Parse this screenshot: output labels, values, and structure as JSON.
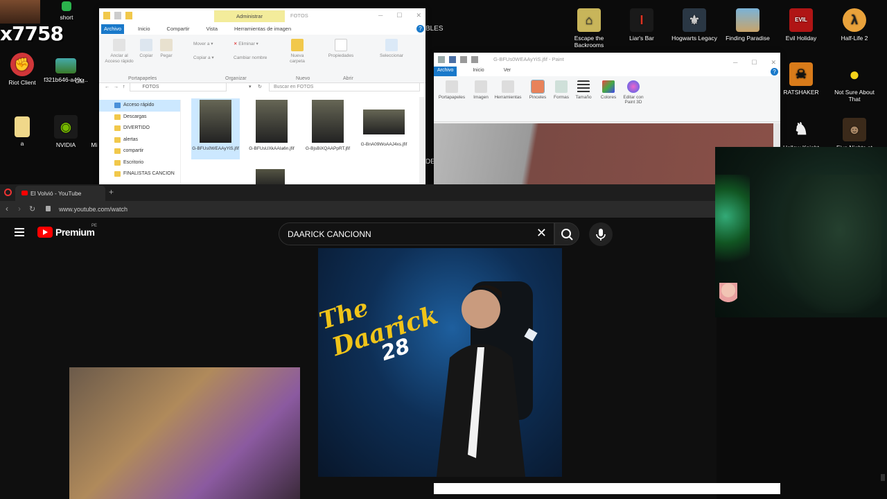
{
  "desktop": {
    "overlay_number": "x7758",
    "icons": [
      {
        "label": "short"
      },
      {
        "label": "Riot Client"
      },
      {
        "label": "f321b646-a49c..."
      },
      {
        "label": "GM"
      },
      {
        "label": "a"
      },
      {
        "label": "NVIDIA"
      },
      {
        "label": "Mi"
      },
      {
        "label": "Escape the Backrooms"
      },
      {
        "label": "Liar's Bar"
      },
      {
        "label": "Hogwarts Legacy"
      },
      {
        "label": "Finding Paradise"
      },
      {
        "label": "Evil Holiday"
      },
      {
        "label": "Half-Life 2"
      },
      {
        "label": "RATSHAKER"
      },
      {
        "label": "Not Sure About That"
      },
      {
        "label": "Hollow Knight"
      },
      {
        "label": "Five Nights at"
      }
    ],
    "partial_text_bles": "BLES",
    "partial_text_de": "DE"
  },
  "explorer": {
    "title": "FOTOS",
    "context_tab": "Administrar",
    "tabs": [
      "Archivo",
      "Inicio",
      "Compartir",
      "Vista",
      "Herramientas de imagen"
    ],
    "ribbon_buttons": [
      {
        "label": "Anclar al Acceso rápido"
      },
      {
        "label": "Copiar"
      },
      {
        "label": "Pegar"
      },
      {
        "label": "Mover a"
      },
      {
        "label": "Copiar a"
      },
      {
        "label": "Eliminar"
      },
      {
        "label": "Cambiar nombre"
      },
      {
        "label": "Nueva carpeta"
      },
      {
        "label": "Propiedades"
      },
      {
        "label": "Seleccionar"
      }
    ],
    "groups": [
      "Portapapeles",
      "Organizar",
      "Nuevo",
      "Abrir"
    ],
    "path": "FOTOS",
    "search_placeholder": "Buscar en FOTOS",
    "nav": [
      "Acceso rápido",
      "Descargas",
      "DIVERTIDO",
      "alertas",
      "compartir",
      "Escritorio",
      "FINALISTAS CANCION"
    ],
    "files": [
      {
        "name": "G-BFUs0WEAAyYiS.jfif"
      },
      {
        "name": "G-BFUsUXkAAIa6n.jfif"
      },
      {
        "name": "G-BjsBiXQAAPpRT.jfif"
      },
      {
        "name": "G-BnA09WoAAJ4xs.jfif"
      }
    ]
  },
  "paint": {
    "title": "G-BFUs0WEAAyYiS.jfif - Paint",
    "tabs": [
      "Archivo",
      "Inicio",
      "Ver"
    ],
    "tools": [
      {
        "label": "Portapapeles"
      },
      {
        "label": "Imagen"
      },
      {
        "label": "Herramientas"
      },
      {
        "label": "Pinceles"
      },
      {
        "label": "Formas"
      },
      {
        "label": "Tamaño"
      },
      {
        "label": "Colores"
      },
      {
        "label": "Editar con Paint 3D"
      }
    ]
  },
  "browser": {
    "tab_title": "El Volvió - YouTube",
    "url": "www.youtube.com/watch",
    "youtube": {
      "logo_text": "Premium",
      "region": "PE",
      "search_value": "DAARICK CANCIONN"
    },
    "thumbnail": {
      "line1": "The",
      "line2": "Daarick",
      "line3": "28"
    }
  }
}
